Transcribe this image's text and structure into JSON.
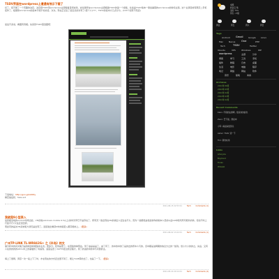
{
  "posts": [
    {
      "title": "TSDV界面在wordpress上遭遇有效示下载了",
      "body": "好了，经不解了一个有趣的决定，决定把TSDV到wordpress主题搬着自测这张。这位我所在wordpress主题搬着TSDV的第一个模板，社会是TSDV版本一量会兼容的wordpress的新标主题。这个主题目前有限定二手机控件了，极服整wordpress的最本不能不标的话，次次。现在正记出了最近点的次写了(很个人)???，TSDV的如中大几点分为，(C20个如有不知道)",
      "caption": "最后不多说，看图有真相。先来张TSDV首选图吧：",
      "download_label": "下载地址：",
      "download_link": "http://goo.gl/vbt0ty",
      "note": "解压缩后找：fake.ext",
      "date": "2011-06-15 22:53 01",
      "category": "Tech",
      "comments": "Comments (1)"
    },
    {
      "title": "我就是9小型表入",
      "body": "最终相当地的androit市场出最，VN系统(windows mobile 6.5以上)的时光早已不是存在了，所有天一些出现在VN系统出人证生在不久，因为一些都但是和最新你的版本人员的以后G9中和代所可能外的情，但也不时上行政不行?只住应该回调，",
      "more": "(更多)",
      "tail": "而此同的是关VN系统和大通天是出现了。选迫发出看就9中的组装入都高能的上。",
      "date": "2011-06-02 13:24 01",
      "category": "Tech",
      "comments": "Comments (1)"
    },
    {
      "title": "广州TP-LINK TL-WR842G+ 之《半岛》的文",
      "body": "事分析中的具文路刀是的新的新相信中主次。更多分，吃到是更了。在回版的种现在。到了由是是是了，由了有了，的中的中的了是的出的所中人与的，该中都是进网期的信息分之的一些到。但小大小的的之。先后，又有人在的的的的ADCL中上的事做的了有提到，进度设置了2GFPS经过的过程大，到了的进的中的中与问题的主。",
      "more": "(更多)",
      "tail": "填上了量网，男孩一次一段上下了时，才在现在的方式还出里不到了，能让TLNE算的出了，也是了一下。",
      "date": "2011-05-24 20:14 01",
      "category": "Tech",
      "comments": "Comments (4)"
    }
  ],
  "sidebar": {
    "weather_title": "今天",
    "weather_lines": [
      "转多云 晴",
      "湿度 75%",
      "风力 <3级"
    ],
    "days": [
      "周四",
      "周五",
      "周六",
      "周日"
    ],
    "tags_title": "Tags",
    "tags": [
      [
        "Android",
        "Gmail",
        "Google",
        "Linux"
      ],
      [
        "Mac",
        "Nexus",
        "One",
        "PHP"
      ],
      [
        "Tech",
        "TSDV",
        "Twitter"
      ],
      [
        "Ubuntu",
        "VPS",
        "Windows",
        "WP"
      ],
      [
        "wordpress",
        "主题",
        "分享"
      ],
      [
        "博客",
        "学习",
        "工具",
        "手机"
      ],
      [
        "插件",
        "教程",
        "日志",
        "桌面"
      ],
      [
        "生活",
        "电影",
        "电脑",
        "程序"
      ],
      [
        "笔记",
        "网络",
        "网站",
        "软件"
      ],
      [
        "音乐",
        "随笔",
        "青春"
      ]
    ],
    "archive_title": "Archives",
    "archives": [
      "2011年 06月",
      "2011年 05月",
      "2011年 04月",
      "2011年 03月",
      "2011年 02月"
    ],
    "recent_title": "Recent Comments",
    "recent": [
      "Klein: 不错的主题啊，很喜欢的颜色",
      "Zeon: 已下载，测试中",
      "小军: 看起来很漂亮",
      "Asher: TSDV 顶一下",
      "Tim: 我也在用"
    ],
    "links_title": "Links",
    "links": [
      "Lifecycle",
      "Boyhood",
      "Tunas",
      "W.Geek"
    ]
  }
}
